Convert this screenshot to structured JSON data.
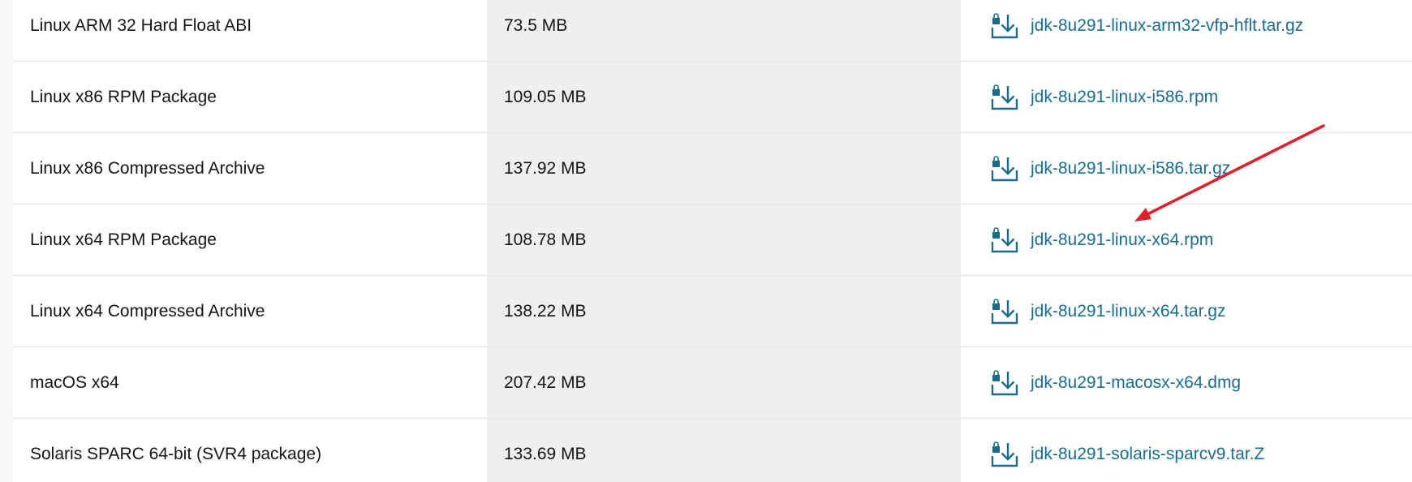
{
  "table": {
    "rows": [
      {
        "product": "Linux ARM 32 Hard Float ABI",
        "size": "73.5 MB",
        "file": "jdk-8u291-linux-arm32-vfp-hflt.tar.gz"
      },
      {
        "product": "Linux x86 RPM Package",
        "size": "109.05 MB",
        "file": "jdk-8u291-linux-i586.rpm"
      },
      {
        "product": "Linux x86 Compressed Archive",
        "size": "137.92 MB",
        "file": "jdk-8u291-linux-i586.tar.gz"
      },
      {
        "product": "Linux x64 RPM Package",
        "size": "108.78 MB",
        "file": "jdk-8u291-linux-x64.rpm"
      },
      {
        "product": "Linux x64 Compressed Archive",
        "size": "138.22 MB",
        "file": "jdk-8u291-linux-x64.tar.gz"
      },
      {
        "product": "macOS x64",
        "size": "207.42 MB",
        "file": "jdk-8u291-macosx-x64.dmg"
      },
      {
        "product": "Solaris SPARC 64-bit (SVR4 package)",
        "size": "133.69 MB",
        "file": "jdk-8u291-solaris-sparcv9.tar.Z"
      }
    ]
  },
  "icons": {
    "download": "lock-download-icon"
  },
  "colors": {
    "link": "#1d6b8c",
    "text": "#161513",
    "size_column_bg": "#f0efed",
    "annotation_arrow": "#e0202a"
  }
}
